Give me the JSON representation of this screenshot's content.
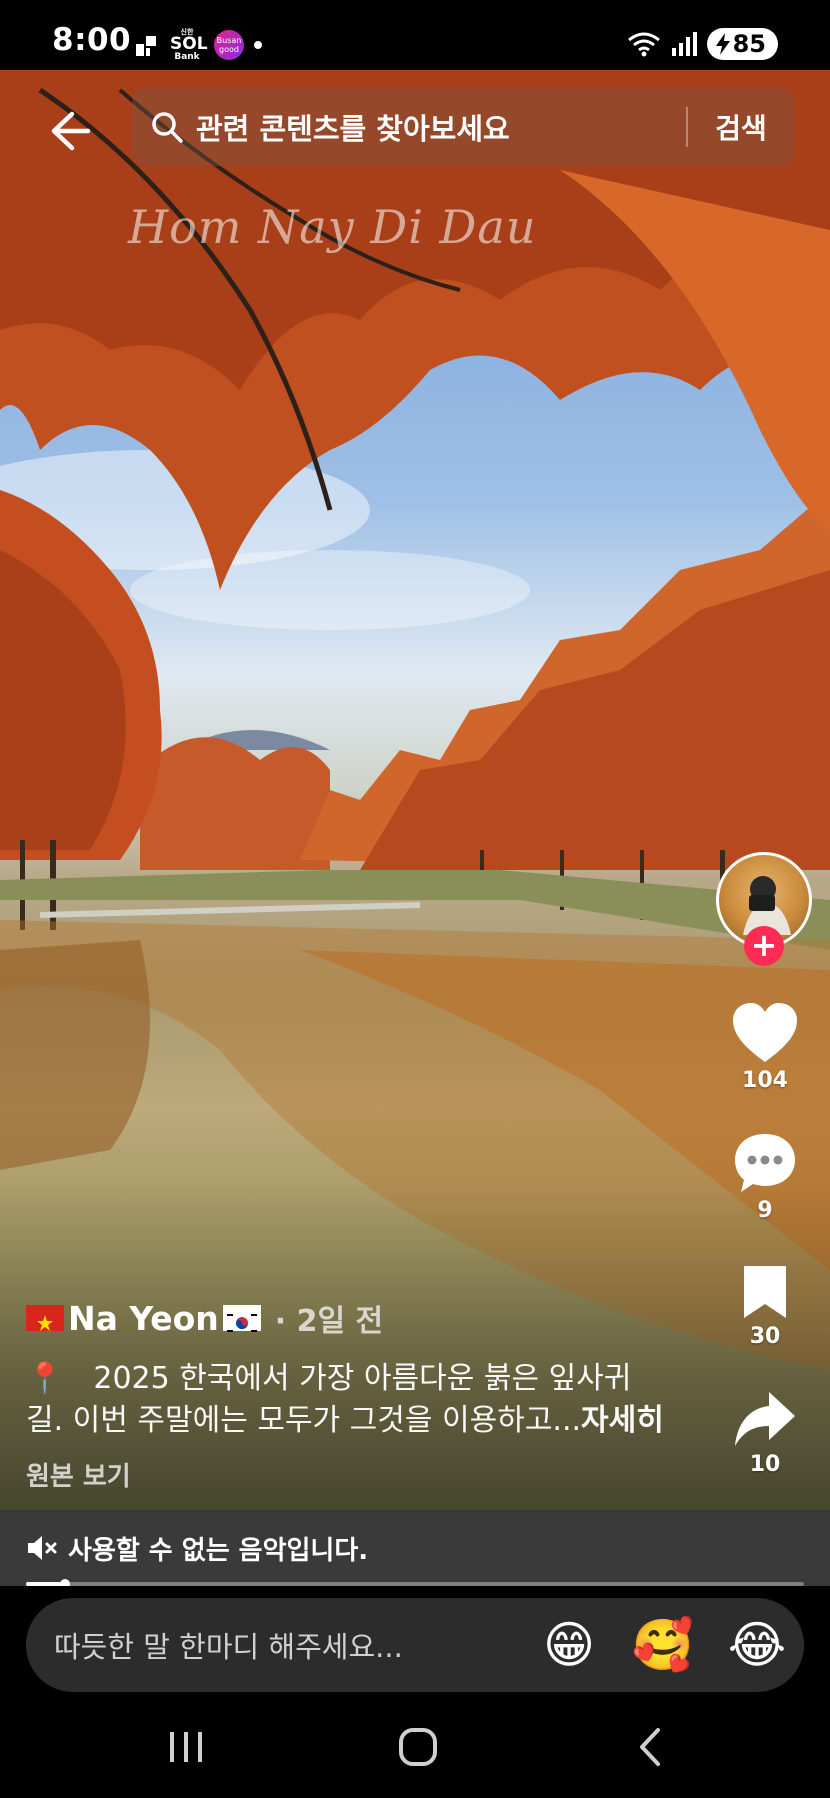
{
  "status_bar": {
    "time": "8:00",
    "bank_logo_small": "신한",
    "bank_logo_big": "SOL",
    "bank_logo_sub": "Bank",
    "busan_logo": "Busan good",
    "battery": "85",
    "icons": [
      "notification-icon",
      "wifi-icon",
      "signal-icon",
      "battery-icon"
    ]
  },
  "search": {
    "placeholder": "관련 콘텐츠를 찾아보세요",
    "button_label": "검색"
  },
  "video": {
    "watermark": "Hom Nay Di Dau"
  },
  "actions": {
    "likes": "104",
    "comments": "9",
    "saves": "30",
    "shares": "10"
  },
  "post": {
    "author": "Na Yeon",
    "time_ago": "· 2일 전",
    "caption": "📍　2025 한국에서 가장 아름다운 붉은 잎사귀 길. 이번 주말에는 모두가 그것을 이용하고...",
    "see_more": "자세히",
    "view_original": "원본 보기"
  },
  "music": {
    "text": "사용할 수 없는 음악입니다.",
    "progress_fraction": 0.05
  },
  "comment": {
    "placeholder": "따듯한 말 한마디 해주세요...",
    "emojis": [
      "😁",
      "🥰",
      "😂"
    ]
  },
  "colors": {
    "accent": "#fe2c55",
    "foliage": "#c9521e",
    "sky": "#8fb4e3"
  }
}
